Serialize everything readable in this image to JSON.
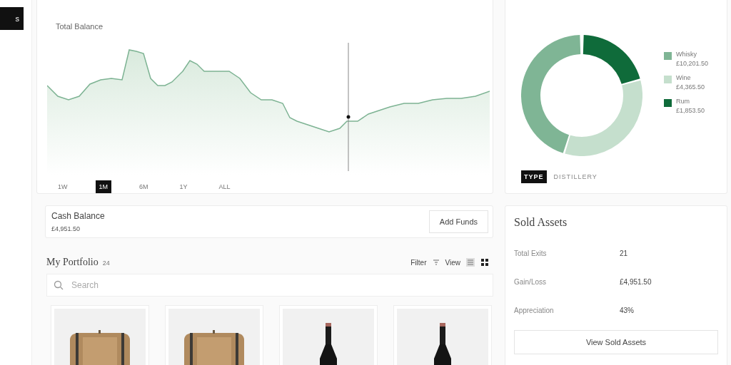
{
  "side_button": {
    "label": "s"
  },
  "balance": {
    "label": "Total Balance"
  },
  "periods": [
    {
      "label": "1W",
      "selected": false
    },
    {
      "label": "1M",
      "selected": true
    },
    {
      "label": "6M",
      "selected": false
    },
    {
      "label": "1Y",
      "selected": false
    },
    {
      "label": "ALL",
      "selected": false
    }
  ],
  "breakdown": {
    "legend": [
      {
        "name": "Whisky",
        "value": "£10,201.50",
        "color": "#7fb595"
      },
      {
        "name": "Wine",
        "value": "£4,365.50",
        "color": "#c5dfcd"
      },
      {
        "name": "Rum",
        "value": "£1,853.50",
        "color": "#0f6b3a"
      }
    ],
    "toggle": [
      {
        "label": "TYPE",
        "selected": true
      },
      {
        "label": "DISTILLERY",
        "selected": false
      }
    ]
  },
  "cash": {
    "label": "Cash Balance",
    "amount": "£4,951.50",
    "button": "Add Funds"
  },
  "portfolio": {
    "title": "My Portfolio",
    "count": "24",
    "filter": "Filter",
    "view": "View",
    "search_placeholder": "Search",
    "items": [
      {
        "kind": "barrel"
      },
      {
        "kind": "barrel"
      },
      {
        "kind": "bottle"
      },
      {
        "kind": "bottle"
      }
    ]
  },
  "sold": {
    "title": "Sold Assets",
    "rows": [
      {
        "label": "Total Exits",
        "value": "21"
      },
      {
        "label": "Gain/Loss",
        "value": "£4,951.50"
      },
      {
        "label": "Appreciation",
        "value": "43%"
      }
    ],
    "button": "View Sold Assets"
  }
}
